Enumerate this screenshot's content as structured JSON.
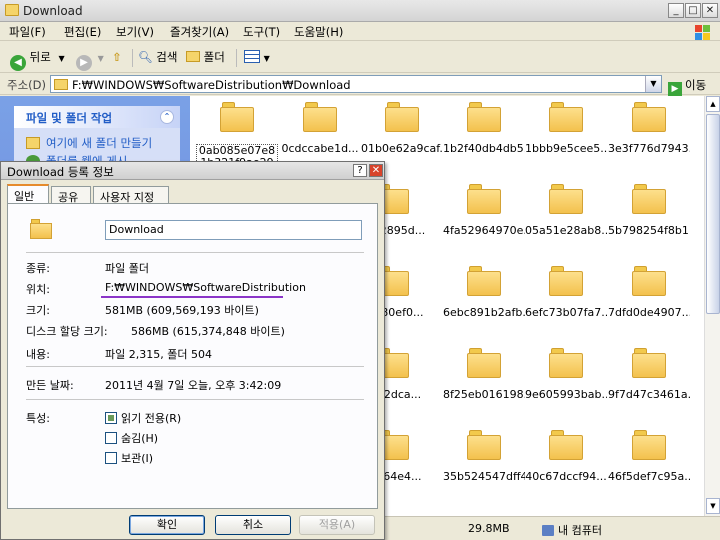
{
  "window": {
    "title": "Download",
    "controls": {
      "minimize": "_",
      "maximize": "□",
      "close": "✕"
    }
  },
  "menu": [
    "파일(F)",
    "편집(E)",
    "보기(V)",
    "즐겨찾기(A)",
    "도구(T)",
    "도움말(H)"
  ],
  "toolbar": {
    "back": "뒤로",
    "search": "검색",
    "folders": "폴더"
  },
  "address": {
    "label": "주소(D)",
    "path": "F:₩WINDOWS₩SoftwareDistribution₩Download",
    "go": "이동"
  },
  "taskpane": {
    "title": "파일 및 폴더 작업",
    "items": [
      "여기에 새 폴더 만들기",
      "폴더를 웹에 게시"
    ]
  },
  "folders": [
    {
      "name": "0ab085e07e81b321f9ae293da2c",
      "selected": true
    },
    {
      "name": "0cdccabe1d..."
    },
    {
      "name": "01b0e62a9caf..."
    },
    {
      "name": "1b2f40db4db5..."
    },
    {
      "name": "1bbb9e5cee5..."
    },
    {
      "name": "3e3f776d7943..."
    },
    {
      "name": "b452895d..."
    },
    {
      "name": "4fa52964970e..."
    },
    {
      "name": "05a51e28ab8..."
    },
    {
      "name": "5b798254f8b1..."
    },
    {
      "name": "07e80ef0..."
    },
    {
      "name": "6ebc891b2afb..."
    },
    {
      "name": "6efc73b07fa7..."
    },
    {
      "name": "7dfd0de4907..."
    },
    {
      "name": "d882dca..."
    },
    {
      "name": "8f25eb016198..."
    },
    {
      "name": "9e605993bab..."
    },
    {
      "name": "9f7d47c3461a..."
    },
    {
      "name": "2a964e4..."
    },
    {
      "name": "35b524547dff4..."
    },
    {
      "name": "40c67dccf94..."
    },
    {
      "name": "46f5def7c95a..."
    }
  ],
  "status": {
    "size": "29.8MB",
    "location": "내 컴퓨터"
  },
  "dialog": {
    "title": "Download 등록 정보",
    "tabs": [
      "일반",
      "공유",
      "사용자 지정"
    ],
    "name": "Download",
    "rows": [
      {
        "label": "종류:",
        "value": "파일 폴더"
      },
      {
        "label": "위치:",
        "value": "F:₩WINDOWS₩SoftwareDistribution"
      },
      {
        "label": "크기:",
        "value": "581MB (609,569,193 바이트)"
      },
      {
        "label": "디스크 할당 크기:",
        "value": "586MB (615,374,848 바이트)"
      },
      {
        "label": "내용:",
        "value": "파일 2,315, 폴더 504"
      },
      {
        "label": "만든 날짜:",
        "value": "2011년 4월 7일 오늘, 오후 3:42:09"
      }
    ],
    "attributes_label": "특성:",
    "attributes": [
      {
        "label": "읽기 전용(R)",
        "checked": true
      },
      {
        "label": "숨김(H)",
        "checked": false
      },
      {
        "label": "보관(I)",
        "checked": false
      }
    ],
    "buttons": {
      "ok": "확인",
      "cancel": "취소",
      "apply": "적용(A)"
    }
  }
}
